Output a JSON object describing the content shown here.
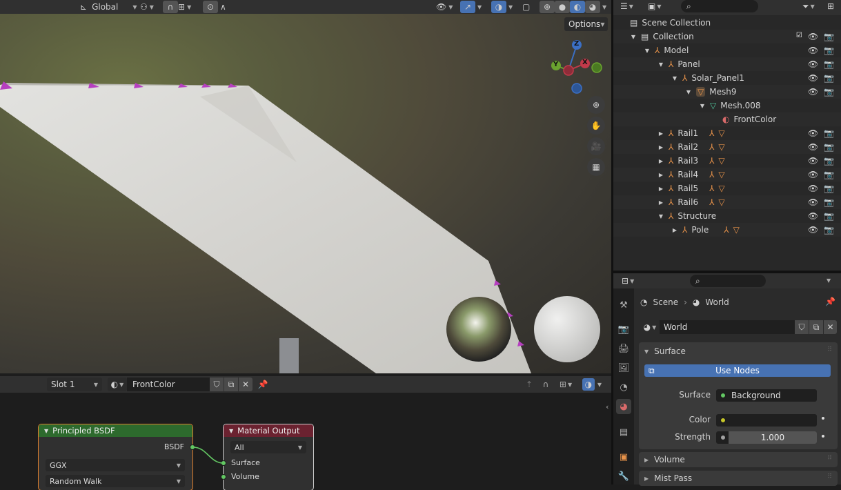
{
  "viewport": {
    "orientation_label": "Global",
    "options_label": "Options",
    "gizmo": {
      "z": "Z",
      "y": "Y",
      "x": "X"
    }
  },
  "node_editor": {
    "slot_label": "Slot 1",
    "material_name": "FrontColor",
    "principled": {
      "title": "Principled BSDF",
      "output": "BSDF",
      "distribution": "GGX",
      "subsurface": "Random Walk"
    },
    "output_node": {
      "title": "Material Output",
      "target": "All",
      "surface": "Surface",
      "volume": "Volume"
    }
  },
  "outliner": {
    "root": "Scene Collection",
    "rows": [
      {
        "label": "Collection",
        "depth": 0
      },
      {
        "label": "Model",
        "depth": 1
      },
      {
        "label": "Panel",
        "depth": 2
      },
      {
        "label": "Solar_Panel1",
        "depth": 3
      },
      {
        "label": "Mesh9",
        "depth": 4
      },
      {
        "label": "Mesh.008",
        "depth": 5
      },
      {
        "label": "FrontColor",
        "depth": 6
      },
      {
        "label": "Rail1",
        "depth": 2
      },
      {
        "label": "Rail2",
        "depth": 2
      },
      {
        "label": "Rail3",
        "depth": 2
      },
      {
        "label": "Rail4",
        "depth": 2
      },
      {
        "label": "Rail5",
        "depth": 2
      },
      {
        "label": "Rail6",
        "depth": 2
      },
      {
        "label": "Structure",
        "depth": 2
      },
      {
        "label": "Pole",
        "depth": 3
      }
    ]
  },
  "properties": {
    "breadcrumb_scene": "Scene",
    "breadcrumb_world": "World",
    "world_name": "World",
    "surface_panel": "Surface",
    "use_nodes_label": "Use Nodes",
    "surface_label": "Surface",
    "surface_value": "Background",
    "color_label": "Color",
    "strength_label": "Strength",
    "strength_value": "1.000",
    "volume_panel": "Volume",
    "mist_panel": "Mist Pass"
  },
  "colors": {
    "accent_blue": "#4772b3",
    "node_green": "#2d6a2d",
    "node_red": "#6b2230",
    "socket_green": "#63c763",
    "socket_yellow": "#c7c729",
    "object_orange": "#e8934a"
  }
}
